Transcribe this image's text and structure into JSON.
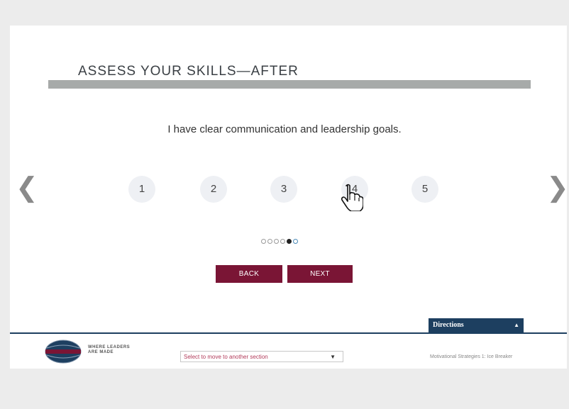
{
  "header": {
    "title": "ASSESS YOUR SKILLS—AFTER"
  },
  "question": "I have clear communication and leadership goals.",
  "ratings": [
    "1",
    "2",
    "3",
    "4",
    "5"
  ],
  "nav": {
    "prev_arrow": "❮",
    "next_arrow": "❯"
  },
  "buttons": {
    "back": "BACK",
    "next": "NEXT"
  },
  "progress": {
    "total": 6,
    "current": 5
  },
  "directions": {
    "label": "Directions",
    "caret": "▲"
  },
  "footer": {
    "tagline_line1": "WHERE LEADERS",
    "tagline_line2": "ARE MADE",
    "section_select": {
      "value": "Select to move to another section",
      "caret": "▼"
    },
    "meta": "Motivational Strategies 1: Ice Breaker"
  },
  "colors": {
    "accent": "#7a1535",
    "navy": "#1d3f60",
    "title_bar": "#a7aaa9"
  }
}
